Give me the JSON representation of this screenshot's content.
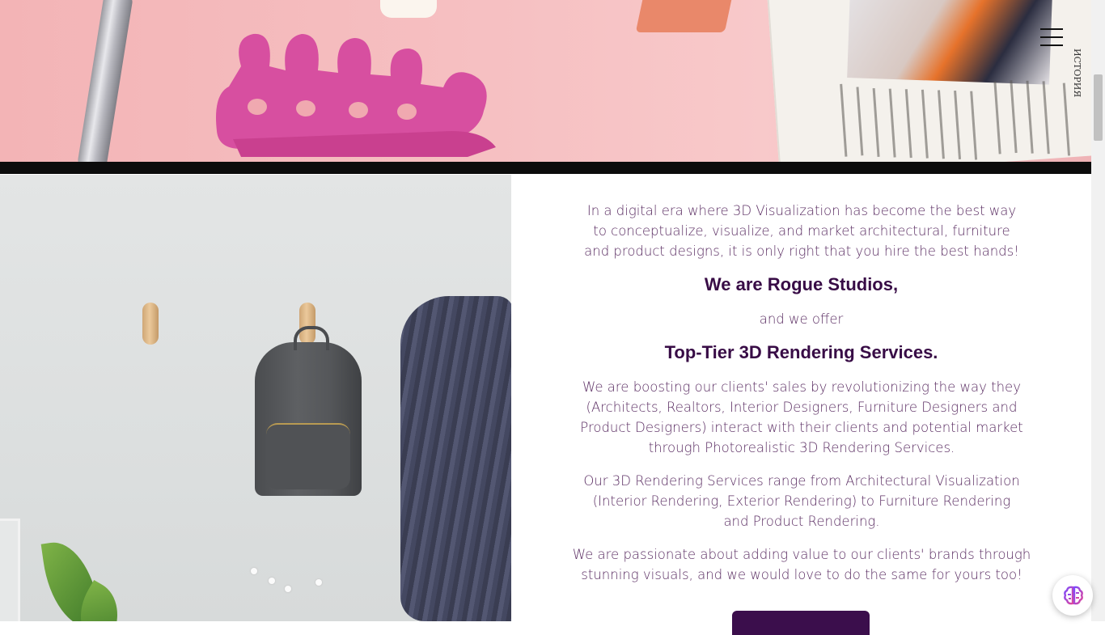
{
  "header": {
    "menu_icon": "hamburger-menu-icon"
  },
  "hero": {
    "image_subject": "nail-care-flatlay",
    "magazine_caption": "ИСТОРИЯ"
  },
  "side_image": {
    "image_subject": "backpack-on-wall-hooks"
  },
  "content": {
    "intro": "In a digital era where 3D Visualization has become the best way to conceptualize, visualize, and market architectural, furniture and product designs, it is only right that you hire the best hands!",
    "studios_heading": "We are Rogue Studios,",
    "offer_text": "and we offer",
    "services_heading": "Top-Tier 3D Rendering Services.",
    "boosting": "We are boosting our clients' sales by revolutionizing the way they (Architects, Realtors, Interior Designers, Furniture Designers and Product Designers) interact with their clients and potential market through Photorealistic 3D Rendering Services.",
    "range": "Our 3D Rendering Services range from Architectural Visualization (Interior Rendering, Exterior Rendering) to Furniture Rendering and Product Rendering.",
    "passion": "We are passionate about adding value to our clients' brands through stunning visuals, and we would love to do the same for yours too!"
  },
  "widget": {
    "icon": "brain-icon"
  },
  "colors": {
    "heading": "#380c46",
    "body_text": "#5b2e63",
    "button": "#3b0e4c",
    "band": "#0c0c0c"
  }
}
